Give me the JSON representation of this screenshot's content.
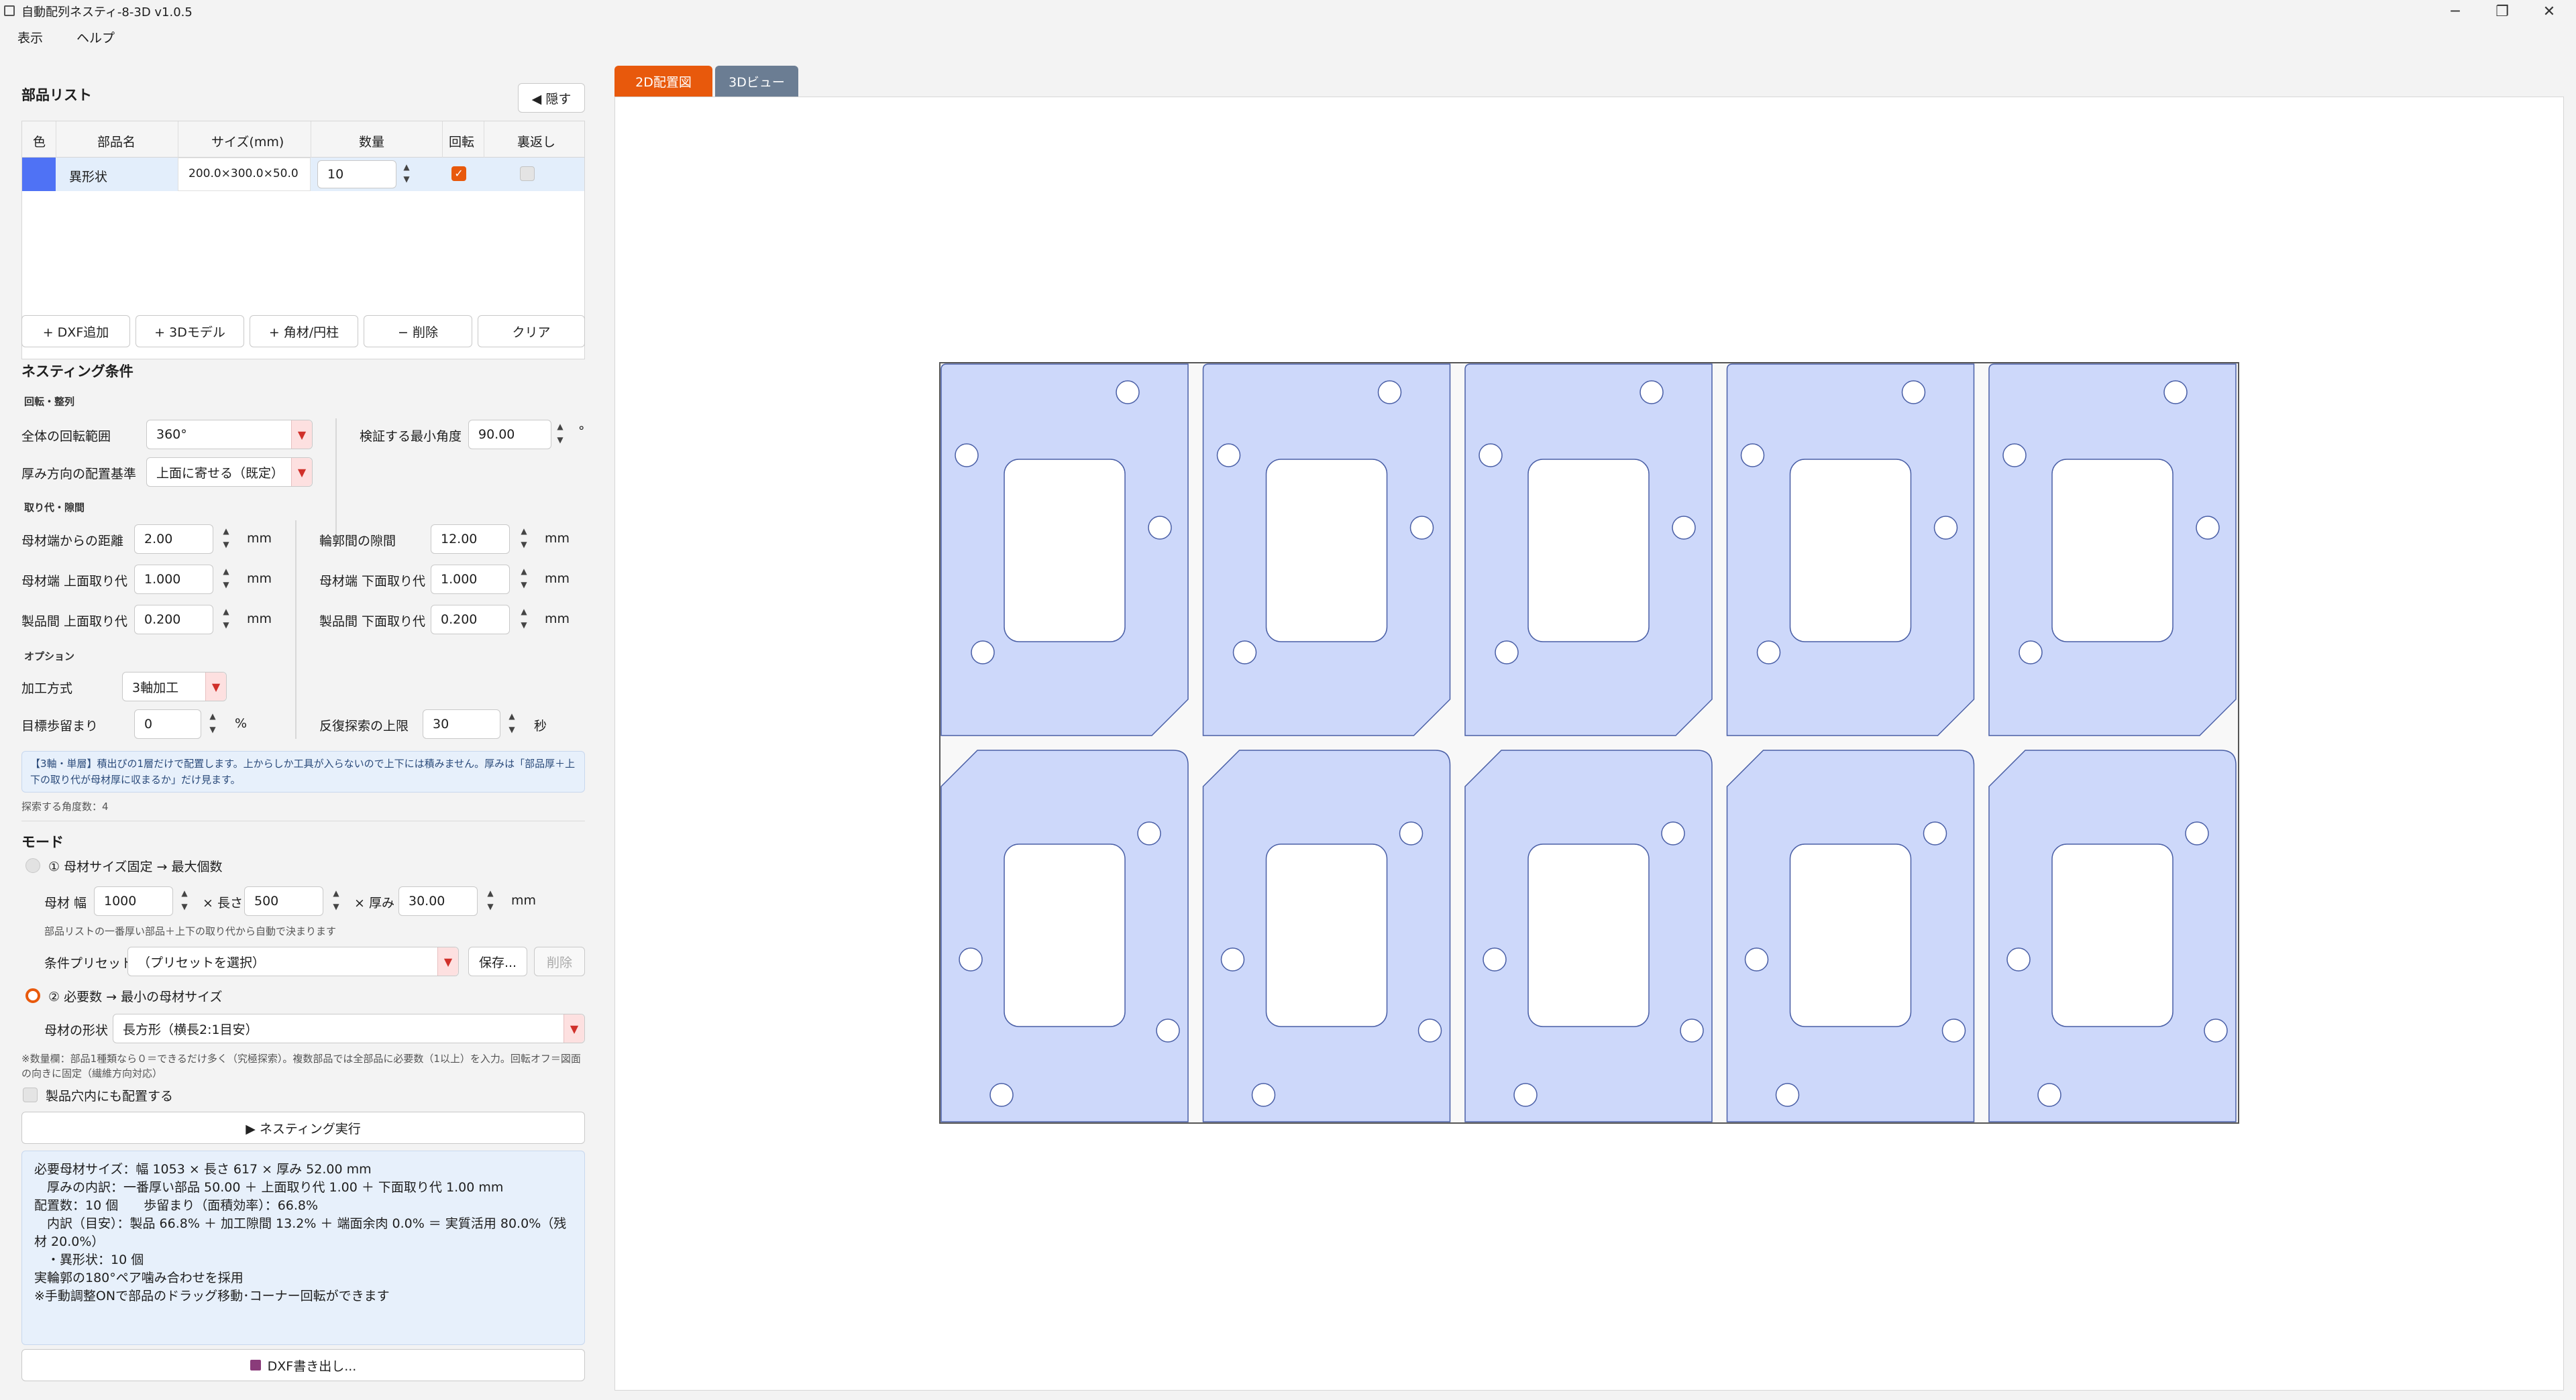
{
  "window": {
    "title": "自動配列ネスティ-8-3D v1.0.5",
    "menu": [
      "表示",
      "ヘルプ"
    ]
  },
  "parts": {
    "title": "部品リスト",
    "hide_label": "◀ 隠す",
    "columns": [
      "色",
      "部品名",
      "サイズ(mm)",
      "数量",
      "回転",
      "裏返し"
    ],
    "rows": [
      {
        "color": "#4f72f5",
        "name": "異形状",
        "size": "200.0×300.0×50.0",
        "qty": "10",
        "rotate": true,
        "flip": false
      }
    ],
    "buttons": [
      "+ DXF追加",
      "+ 3Dモデル",
      "+ 角材/円柱",
      "− 削除",
      "クリア"
    ]
  },
  "nesting": {
    "title": "ネスティング条件",
    "rotation_section": "回転・整列",
    "rot_range_label": "全体の回転範囲",
    "rot_range_value": "360°",
    "min_angle_label": "検証する最小角度",
    "min_angle_value": "90.00",
    "min_angle_unit": "°",
    "thickness_label": "厚み方向の配置基準",
    "thickness_value": "上面に寄せる（既定）",
    "margin_section": "取り代・隙間",
    "edge_dist_label": "母材端からの距離",
    "edge_dist_value": "2.00",
    "contour_gap_label": "輪郭間の隙間",
    "contour_gap_value": "12.00",
    "edge_top_label": "母材端 上面取り代",
    "edge_top_value": "1.000",
    "edge_bottom_label": "母材端 下面取り代",
    "edge_bottom_value": "1.000",
    "prod_top_label": "製品間 上面取り代",
    "prod_top_value": "0.200",
    "prod_bottom_label": "製品間 下面取り代",
    "prod_bottom_value": "0.200",
    "unit_mm": "mm",
    "option_section": "オプション",
    "process_label": "加工方式",
    "process_value": "3軸加工",
    "yield_label": "目標歩留まり",
    "yield_value": "0",
    "yield_unit": "%",
    "search_label": "反復探索の上限",
    "search_value": "30",
    "search_unit": "秒",
    "info_text": "【3軸・単層】積出ぴの1層だけで配置します。上からしか工具が入らないので上下には積みません。厚みは「部品厚＋上下の取り代が母材厚に収まるか」だけ見ます。",
    "angle_count": "探索する角度数：4"
  },
  "mode": {
    "title": "モード",
    "opt1_label": "① 母材サイズ固定 → 最大個数",
    "width_label": "母材 幅",
    "width_value": "1000",
    "length_label": "× 長さ",
    "length_value": "500",
    "thick_label": "× 厚み",
    "thick_value": "30.00",
    "unit": "mm",
    "auto_note": "部品リストの一番厚い部品＋上下の取り代から自動で決まります",
    "preset_label": "条件プリセット",
    "preset_value": "（プリセットを選択）",
    "save_label": "保存...",
    "delete_label": "削除",
    "opt2_label": "② 必要数 → 最小の母材サイズ",
    "shape_label": "母材の形状",
    "shape_value": "長方形（横長2:1目安）",
    "qty_note": "※数量欄：部品1種類なら０＝できるだけ多く（究極探索）。複数部品では全部品に必要数（1以上）を入力。回転オフ＝図面の向きに固定（繊維方向対応）",
    "holes_label": "製品穴内にも配置する",
    "run_label": "▶ ネスティング実行",
    "export_label": "DXF書き出し..."
  },
  "result": {
    "lines": [
      "必要母材サイズ：幅 1053 × 長さ 617 × 厚み 52.00 mm",
      "　厚みの内訳：一番厚い部品 50.00 ＋ 上面取り代 1.00 ＋ 下面取り代 1.00 mm",
      "配置数：10 個　　歩留まり（面積効率）：66.8%",
      "　内訳（目安）：製品 66.8% ＋ 加工隙間 13.2% ＋ 端面余肉 0.0% ＝ 実質活用 80.0%（残材 20.0%）",
      "　・異形状：10 個",
      "実輪郭の180°ペア噛み合わせを採用",
      "※手動調整ONで部品のドラッグ移動･コーナー回転ができます"
    ]
  },
  "tabs": [
    "2D配置図",
    "3Dビュー"
  ],
  "colors": {
    "accent": "#e8590c",
    "tab_inactive": "#6b7d93",
    "part_fill": "#cdd8fa",
    "part_stroke": "#4a5fa6",
    "info_bg": "#e7f0fb"
  }
}
